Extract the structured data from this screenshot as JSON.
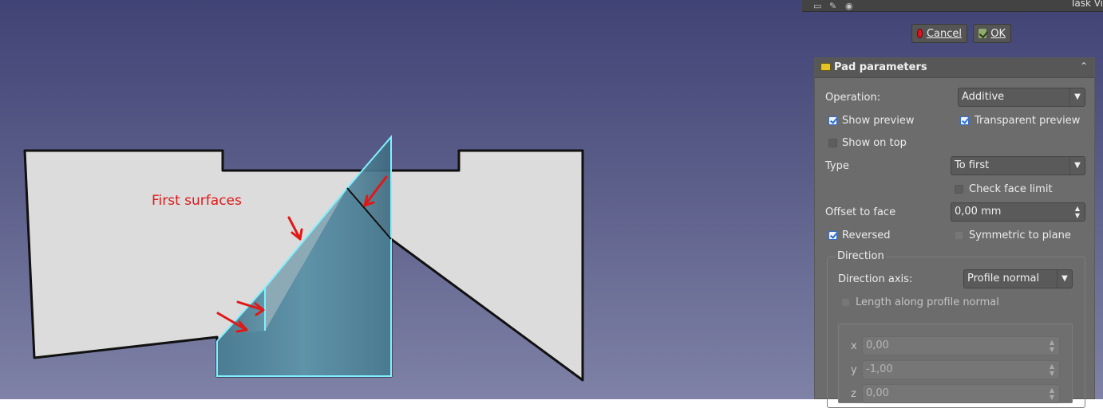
{
  "viewport": {
    "annotation": "First surfaces",
    "colors": {
      "surface": "#dcdcdc",
      "edge": "#111111",
      "preview_fill": "#4f8aa3",
      "preview_edge": "#7ff0ff",
      "arrow": "#e01818"
    }
  },
  "panel_top": {
    "title": "Task Vi",
    "icons": [
      "save-icon",
      "edit-icon",
      "eye-icon"
    ]
  },
  "buttons": {
    "cancel": "Cancel",
    "ok": "OK"
  },
  "pad": {
    "title": "Pad parameters",
    "operation_label": "Operation:",
    "operation_value": "Additive",
    "show_preview": "Show preview",
    "transparent_preview": "Transparent preview",
    "show_on_top": "Show on top",
    "type_label": "Type",
    "type_value": "To first",
    "check_face_limit": "Check face limit",
    "offset_label": "Offset to face",
    "offset_value": "0,00 mm",
    "reversed": "Reversed",
    "symmetric": "Symmetric to plane",
    "direction": {
      "title": "Direction",
      "axis_label": "Direction axis:",
      "axis_value": "Profile normal",
      "length_along": "Length along profile normal",
      "x_label": "x",
      "x_value": "0,00",
      "y_label": "y",
      "y_value": "-1,00",
      "z_label": "z",
      "z_value": "0,00"
    }
  }
}
